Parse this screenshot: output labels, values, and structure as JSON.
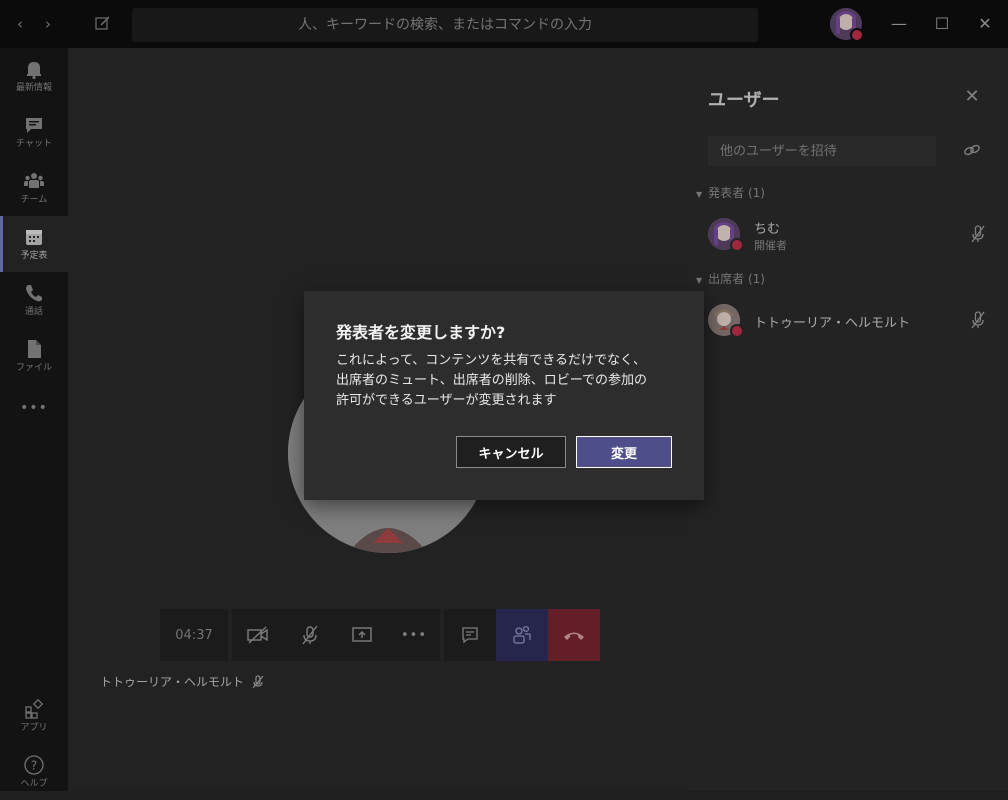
{
  "titlebar": {
    "search_placeholder": "人、キーワードの検索、またはコマンドの入力",
    "back_icon": "chevron-left-icon",
    "forward_icon": "chevron-right-icon",
    "compose_icon": "compose-icon",
    "minimize": "—",
    "maximize": "☐",
    "close": "✕"
  },
  "rail": {
    "items": [
      {
        "label": "最新情報",
        "icon": "bell-icon"
      },
      {
        "label": "チャット",
        "icon": "chat-icon"
      },
      {
        "label": "チーム",
        "icon": "teams-icon"
      },
      {
        "label": "予定表",
        "icon": "calendar-icon",
        "active": true
      },
      {
        "label": "通話",
        "icon": "phone-icon"
      },
      {
        "label": "ファイル",
        "icon": "file-icon"
      },
      {
        "label": "",
        "icon": "more-icon"
      }
    ],
    "bottom": [
      {
        "label": "アプリ",
        "icon": "apps-icon"
      },
      {
        "label": "ヘルプ",
        "icon": "help-icon"
      }
    ],
    "more_glyph": "•••",
    "help_glyph": "?"
  },
  "stage": {
    "timer": "04:37",
    "more_glyph": "•••",
    "participant_name": "トトゥーリア・ヘルモルト"
  },
  "panel": {
    "title": "ユーザー",
    "close_glyph": "✕",
    "invite_placeholder": "他のユーザーを招待",
    "sections": [
      {
        "label": "発表者 (1)"
      },
      {
        "label": "出席者 (1)"
      }
    ],
    "presenters": [
      {
        "name": "ちむ",
        "role": "開催者"
      }
    ],
    "attendees": [
      {
        "name": "トトゥーリア・ヘルモルト"
      }
    ]
  },
  "dialog": {
    "title": "発表者を変更しますか?",
    "body": "これによって、コンテンツを共有できるだけでなく、\n出席者のミュート、出席者の削除、ロビーでの参加の\n許可ができるユーザーが変更されます",
    "cancel_label": "キャンセル",
    "confirm_label": "変更"
  },
  "colors": {
    "accent": "#6264a7",
    "presence_busy": "#c4314b",
    "hangup": "#c4314b"
  }
}
